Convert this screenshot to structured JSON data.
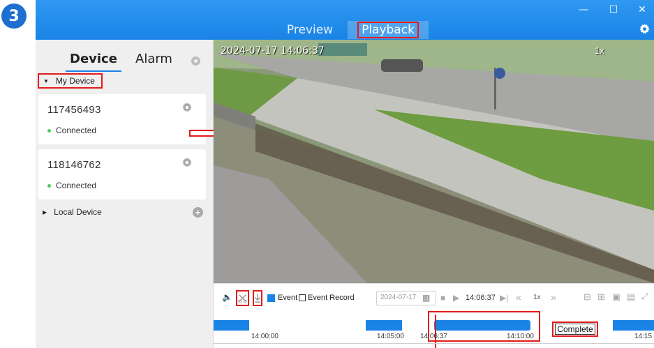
{
  "step_number": "3",
  "window": {
    "tabs": [
      {
        "label": "Preview"
      },
      {
        "label": "Playback"
      }
    ],
    "minimize": "—",
    "maximize": "☐",
    "close": "✕",
    "settings_icon": "gear-icon"
  },
  "sidebar": {
    "tabs": [
      {
        "label": "Device"
      },
      {
        "label": "Alarm"
      }
    ],
    "my_device_label": "My Device",
    "devices": [
      {
        "id": "117456493",
        "status": "Connected"
      },
      {
        "id": "118146762",
        "status": "Connected"
      }
    ],
    "local_device_label": "Local Device",
    "add_label": "+"
  },
  "video": {
    "timestamp": "2024-07-17 14:06:37",
    "speed": "1x"
  },
  "toolbar": {
    "event_label": "Event",
    "event_record_label": "Event Record",
    "date": "2024-07-17",
    "time": "14:06:37",
    "speed": "1x",
    "icons": [
      "volume-icon",
      "clip-icon",
      "download-icon",
      "calendar-icon",
      "stop-icon",
      "play-icon",
      "next-frame-icon",
      "slow-icon",
      "fast-icon",
      "zoom-out-icon",
      "zoom-in-icon",
      "delete-icon",
      "layout-icon",
      "fullscreen-icon"
    ]
  },
  "timeline": {
    "ticks": [
      "14:00:00",
      "14:05:00",
      "14:06:37",
      "14:10:00",
      "14:15"
    ],
    "complete_label": "Complete"
  },
  "colors": {
    "accent": "#1a84e6",
    "highlight": "#e31b1b",
    "online": "#4ccd5a"
  }
}
